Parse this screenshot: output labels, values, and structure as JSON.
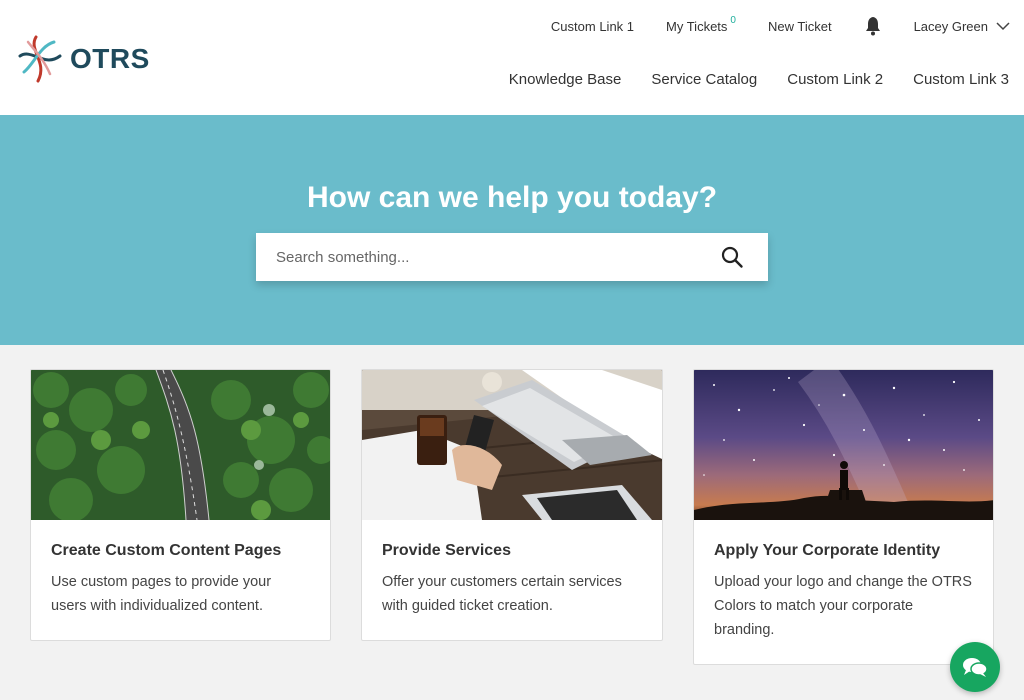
{
  "brand": {
    "name": "OTRS",
    "colors": {
      "primary": "#1f4a5c",
      "hero": "#6abccb",
      "accent": "#1fae9c",
      "chat": "#17a660"
    }
  },
  "top_nav": {
    "items": [
      {
        "label": "Custom Link 1"
      },
      {
        "label": "My Tickets",
        "badge": "0"
      },
      {
        "label": "New Ticket"
      }
    ],
    "notifications_icon": "bell-icon",
    "user": {
      "name": "Lacey Green",
      "icon": "chevron-down-icon"
    }
  },
  "main_nav": {
    "items": [
      {
        "label": "Knowledge Base"
      },
      {
        "label": "Service Catalog"
      },
      {
        "label": "Custom Link 2"
      },
      {
        "label": "Custom Link 3"
      }
    ]
  },
  "hero": {
    "title": "How can we help you today?",
    "search": {
      "placeholder": "Search something...",
      "value": "",
      "icon": "search-icon"
    }
  },
  "cards": [
    {
      "title": "Create Custom Content Pages",
      "text": "Use custom pages to provide your users with individualized content.",
      "image": "forest-road-aerial"
    },
    {
      "title": "Provide Services",
      "text": "Offer your customers certain services with guided ticket creation.",
      "image": "people-at-cafe-table"
    },
    {
      "title": "Apply Your Corporate Identity",
      "text": "Upload your logo and change the OTRS Colors to match your corporate branding.",
      "image": "starry-night-sky"
    }
  ],
  "chat": {
    "icon": "chat-bubbles-icon"
  }
}
